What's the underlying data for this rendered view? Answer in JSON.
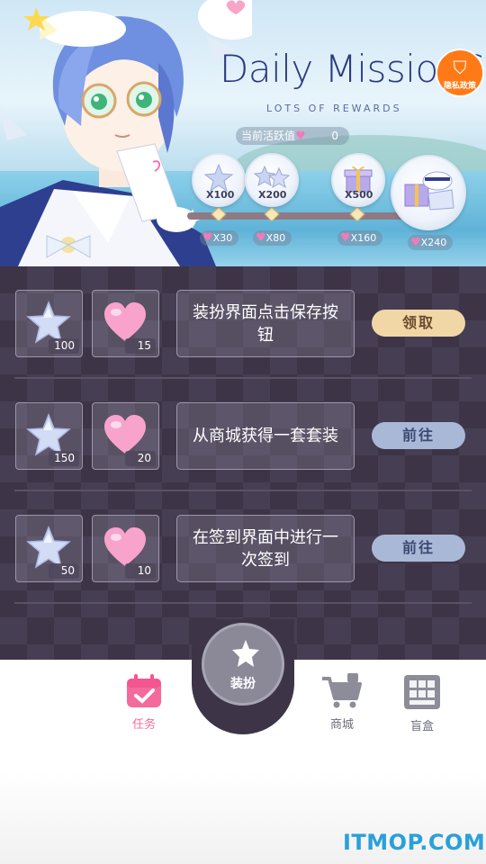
{
  "banner": {
    "title": "Daily MissionS",
    "subtitle": "LOTS OF REWARDS",
    "privacy_label": "隐私政策",
    "activity_label": "当前活跃值",
    "activity_value": "0",
    "rewards": [
      {
        "amount": "X100",
        "hearts": "X30",
        "icon": "star-crystal-icon"
      },
      {
        "amount": "X200",
        "hearts": "X80",
        "icon": "star-crystal-pile-icon"
      },
      {
        "amount": "X500",
        "hearts": "X160",
        "icon": "gift-box-icon"
      },
      {
        "amount": "",
        "hearts": "X240",
        "icon": "gift-bundle-icon"
      }
    ]
  },
  "missions": [
    {
      "star_qty": "100",
      "heart_qty": "15",
      "text": "装扮界面点击保存按钮",
      "action": "领取",
      "state": "claim"
    },
    {
      "star_qty": "150",
      "heart_qty": "20",
      "text": "从商城获得一套套装",
      "action": "前往",
      "state": "go"
    },
    {
      "star_qty": "50",
      "heart_qty": "10",
      "text": "在签到界面中进行一次签到",
      "action": "前往",
      "state": "go"
    }
  ],
  "nav": {
    "tasks": "任务",
    "dress": "装扮",
    "shop": "商城",
    "blindbox": "盲盒"
  },
  "watermark": "ITMOP.COM",
  "colors": {
    "accent_pink": "#f06e9d",
    "panel_bg": "#3d3547",
    "claim_button": "#f1d7a6",
    "go_button": "#aab8d8",
    "privacy_orange": "#ff7a16",
    "title_navy": "#2c3a7e"
  }
}
